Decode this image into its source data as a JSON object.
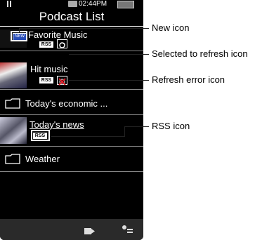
{
  "status": {
    "time": "02:44PM"
  },
  "header": {
    "title": "Podcast List"
  },
  "items": [
    {
      "label": "Favorite Music",
      "rss": "RSS"
    },
    {
      "label": "Hit music",
      "rss": "RSS"
    },
    {
      "label": "Today's economic ..."
    },
    {
      "label": "Today's news",
      "rss": "RSS"
    },
    {
      "label": "Weather"
    }
  ],
  "badges": {
    "new": "NEW"
  },
  "callouts": {
    "new_icon": "New icon",
    "refresh_icon": "Selected to refresh icon",
    "error_icon": "Refresh error icon",
    "rss_icon": "RSS icon"
  },
  "icons": [
    "pause-icon",
    "battery-icon",
    "folder-icon",
    "refresh-icon",
    "refresh-error-icon",
    "rss-icon",
    "playback-icon",
    "options-icon"
  ]
}
